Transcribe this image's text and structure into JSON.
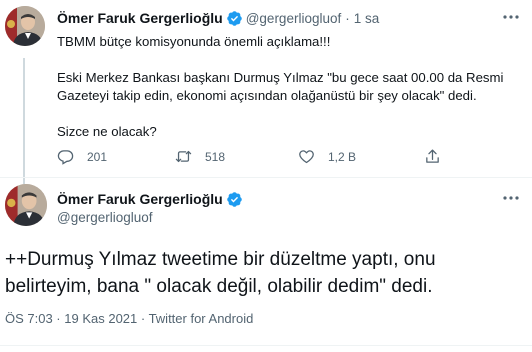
{
  "colors": {
    "verified": "#1d9bf0",
    "secondary_text": "#536471",
    "primary_text": "#0f1419",
    "thread_line": "#cfd9de"
  },
  "tweet1": {
    "author_name": "Ömer Faruk Gergerlioğlu",
    "handle": "@gergerliogluof",
    "separator": "·",
    "time": "1 sa",
    "lines": [
      "TBMM bütçe komisyonunda önemli açıklama!!!",
      "Eski Merkez Bankası başkanı Durmuş Yılmaz \"bu gece saat 00.00 da Resmi",
      "Gazeteyi takip edin, ekonomi açısından olağanüstü bir şey olacak\" dedi.",
      "Sizce ne olacak?"
    ],
    "actions": {
      "reply_count": "201",
      "retweet_count": "518",
      "like_count": "1,2 B"
    },
    "icons": {
      "verified": "verified-badge-icon",
      "more": "more-options-icon",
      "reply": "reply-bubble-icon",
      "retweet": "retweet-arrows-icon",
      "like": "heart-icon",
      "share": "share-upload-icon"
    }
  },
  "tweet2": {
    "author_name": "Ömer Faruk Gergerlioğlu",
    "handle": "@gergerliogluof",
    "lines": [
      "++Durmuş Yılmaz tweetime  bir düzeltme yaptı, onu",
      "belirteyim, bana \" olacak değil, olabilir dedim\" dedi."
    ],
    "meta": "ÖS 7:03 · 19 Kas 2021 · Twitter for Android"
  }
}
